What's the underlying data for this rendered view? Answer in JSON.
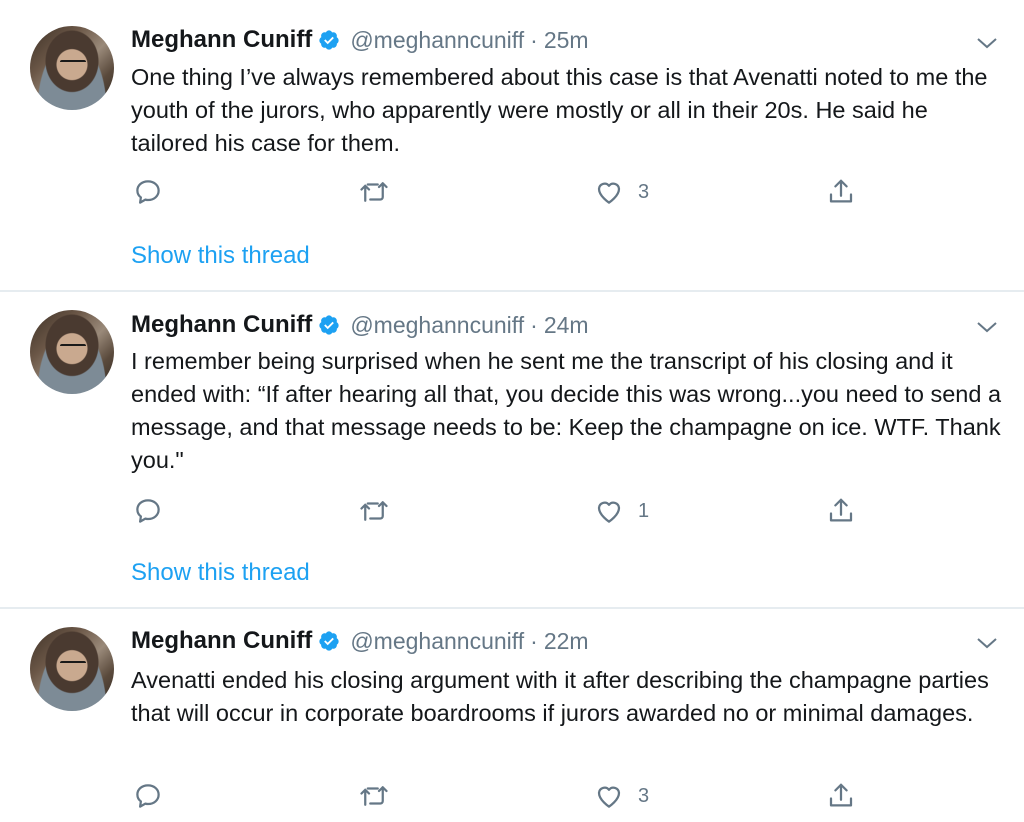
{
  "colors": {
    "text": "#14171a",
    "secondary": "#657786",
    "link": "#1da1f2",
    "verified": "#1da1f2",
    "divider": "#e6ecf0"
  },
  "tweets": [
    {
      "author_name": "Meghann Cuniff",
      "handle": "@meghanncuniff",
      "separator": "·",
      "time": "25m",
      "text": "One thing I’ve always remembered about this case is that Avenatti noted to me the youth of the jurors, who apparently were mostly or all in their 20s. He said he tailored his case for them.",
      "like_count": "3",
      "show_thread": "Show this thread"
    },
    {
      "author_name": "Meghann Cuniff",
      "handle": "@meghanncuniff",
      "separator": "·",
      "time": "24m",
      "text": "I remember being surprised when he sent me the transcript of his closing and it ended with: “If after hearing all that, you decide this was wrong...you need to send a message, and that message needs to be: Keep the champagne on ice. WTF. Thank you.\"",
      "like_count": "1",
      "show_thread": "Show this thread"
    },
    {
      "author_name": "Meghann Cuniff",
      "handle": "@meghanncuniff",
      "separator": "·",
      "time": "22m",
      "text": "Avenatti ended his closing argument with it after describing the champagne parties that will occur in corporate boardrooms if jurors awarded no or minimal damages.",
      "like_count": "3"
    }
  ]
}
